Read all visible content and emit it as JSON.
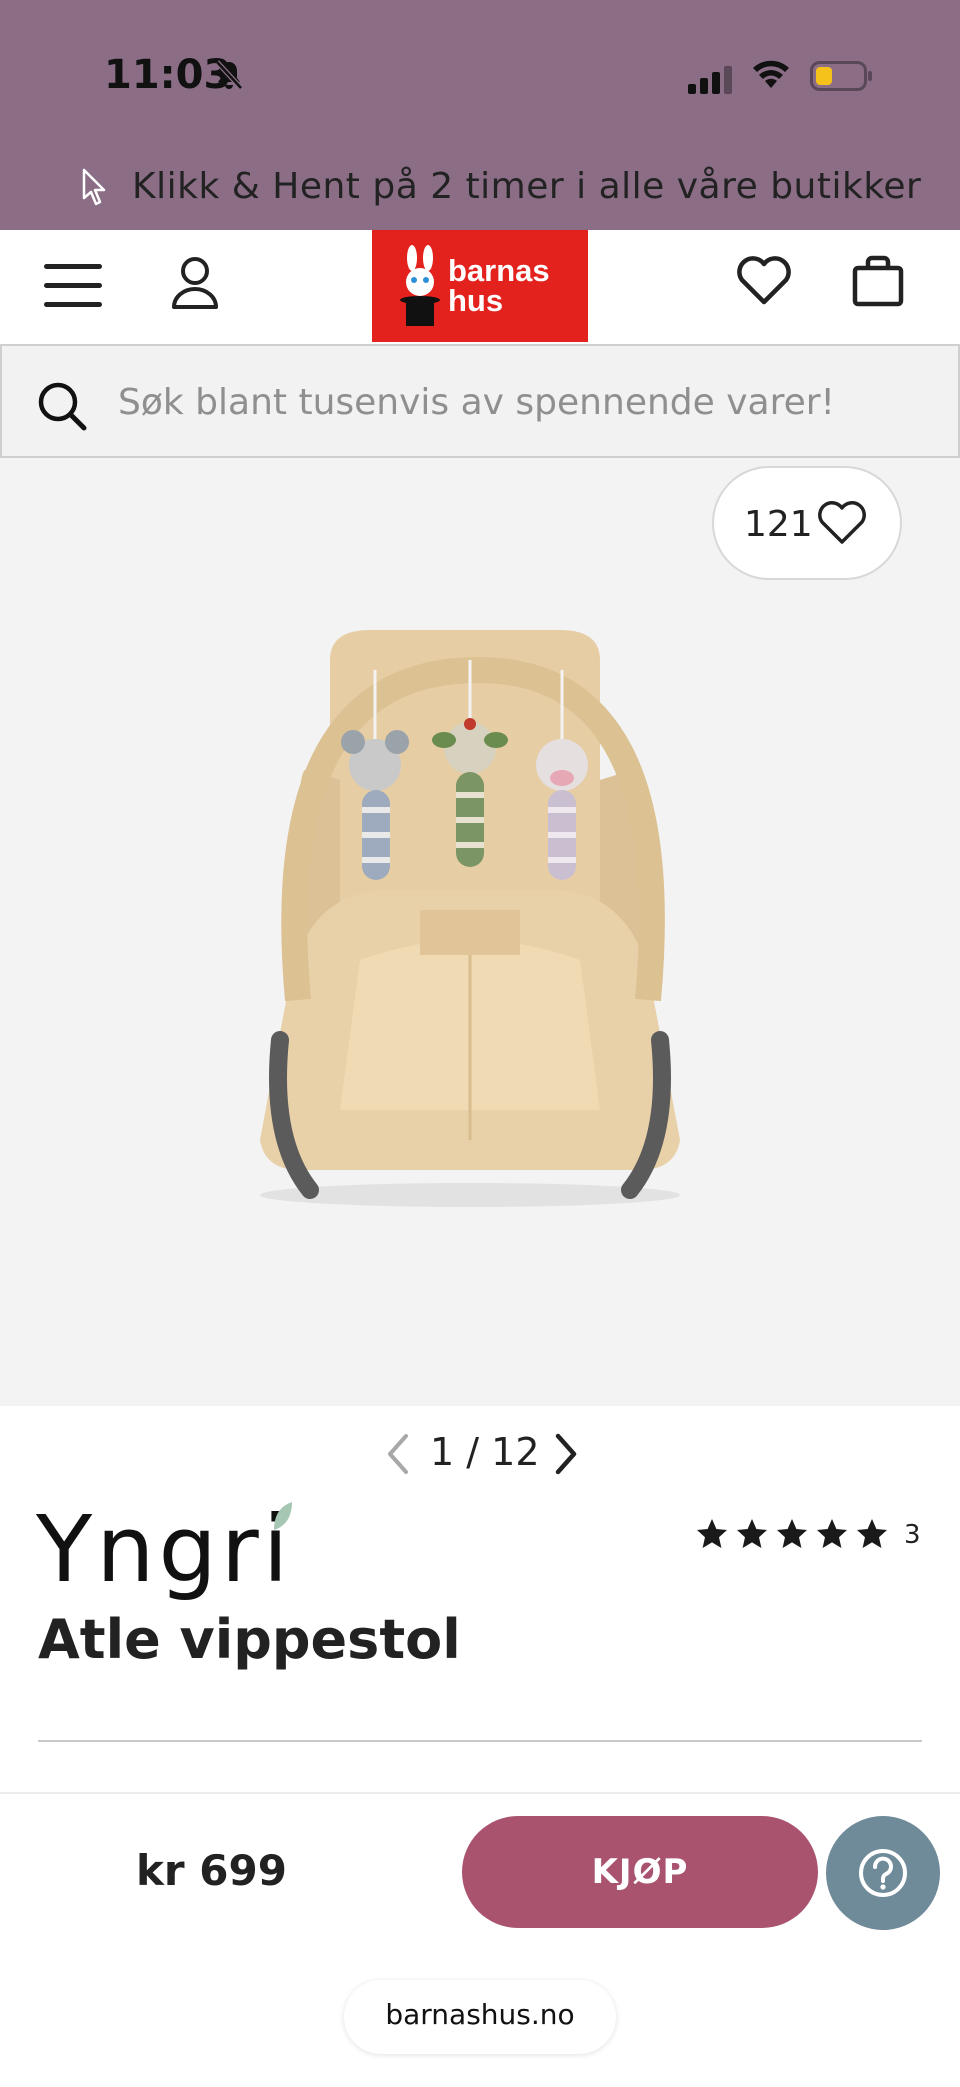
{
  "status_bar": {
    "time": "11:03",
    "icons": [
      "bell-muted-icon",
      "signal-icon",
      "wifi-icon",
      "battery-low-icon"
    ],
    "color": "#8b6e86"
  },
  "promo": {
    "text": "Klikk & Hent på 2 timer i alle våre butikker",
    "icon": "cursor-icon"
  },
  "header": {
    "logo_line1": "barnas",
    "logo_line2": "hus",
    "logo_color": "#e3211d",
    "icons": [
      "menu-icon",
      "user-icon",
      "heart-icon",
      "bag-icon"
    ]
  },
  "search": {
    "placeholder": "Søk blant tusenvis av spennende varer!"
  },
  "product": {
    "like_count": "121",
    "pager_text": "1 / 12",
    "brand": "Yngri",
    "rating_stars": 5,
    "rating_count": "3",
    "title": "Atle vippestol"
  },
  "purchase": {
    "price": "kr 699",
    "buy_label": "KJØP",
    "buy_color": "#a9536f",
    "help_color": "#6f8a99"
  },
  "browser": {
    "url": "barnashus.no"
  }
}
